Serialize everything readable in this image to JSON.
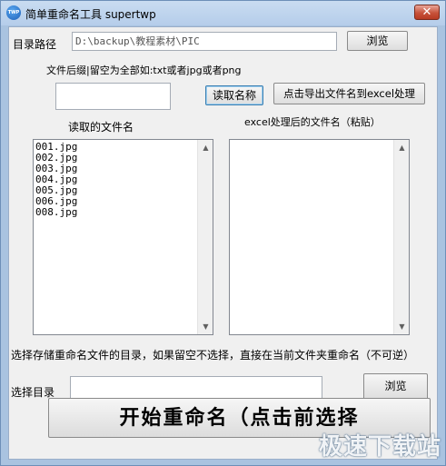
{
  "window": {
    "title": "简单重命名工具 supertwp",
    "icon_text": "TWP",
    "close_glyph": "✕"
  },
  "dir": {
    "label": "目录路径",
    "value": "D:\\backup\\教程素材\\PIC",
    "browse_label": "浏览"
  },
  "suffix": {
    "hint": "文件后缀|留空为全部如:txt或者jpg或者png",
    "value": "",
    "read_label": "读取名称",
    "export_label": "点击导出文件名到excel处理"
  },
  "lists": {
    "left_title": "读取的文件名",
    "right_title": "excel处理后的文件名（粘贴）",
    "left_items": [
      "001.jpg",
      "002.jpg",
      "003.jpg",
      "004.jpg",
      "005.jpg",
      "006.jpg",
      "008.jpg"
    ],
    "right_items": []
  },
  "output": {
    "hint": "选择存储重命名文件的目录，如果留空不选择，直接在当前文件夹重命名（不可逆）",
    "label": "选择目录",
    "value": "",
    "browse_label": "浏览"
  },
  "start": {
    "label": "开始重命名（点击前选择"
  },
  "watermark": "极速下载站"
}
